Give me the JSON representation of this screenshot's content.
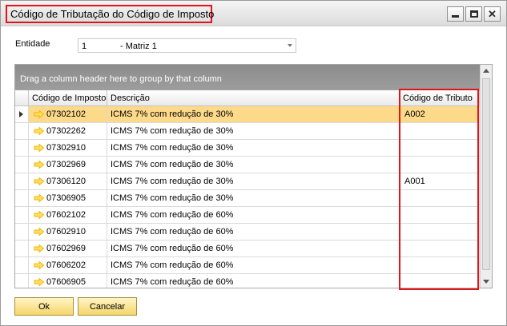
{
  "window": {
    "title": "Código de Tributação do Código de Imposto"
  },
  "entity": {
    "label": "Entidade",
    "code": "1",
    "name": "- Matriz 1"
  },
  "grid": {
    "group_panel_text": "Drag a column header here to group by that column",
    "columns": [
      "Código de Imposto",
      "Descrição",
      "Código de Tributo"
    ],
    "rows": [
      {
        "code": "07302102",
        "desc": "ICMS 7% com redução de 30%",
        "trib": "A002",
        "selected": true
      },
      {
        "code": "07302262",
        "desc": "ICMS 7% com redução de 30%",
        "trib": ""
      },
      {
        "code": "07302910",
        "desc": "ICMS 7% com redução de 30%",
        "trib": ""
      },
      {
        "code": "07302969",
        "desc": "ICMS 7% com redução de 30%",
        "trib": ""
      },
      {
        "code": "07306120",
        "desc": "ICMS 7% com redução de 30%",
        "trib": "A001"
      },
      {
        "code": "07306905",
        "desc": "ICMS 7% com redução de 30%",
        "trib": ""
      },
      {
        "code": "07602102",
        "desc": "ICMS 7% com redução de 60%",
        "trib": ""
      },
      {
        "code": "07602910",
        "desc": "ICMS 7% com redução de 60%",
        "trib": ""
      },
      {
        "code": "07602969",
        "desc": "ICMS 7% com redução de 60%",
        "trib": ""
      },
      {
        "code": "07606202",
        "desc": "ICMS 7% com redução de 60%",
        "trib": ""
      },
      {
        "code": "07606905",
        "desc": "ICMS 7% com redução de 60%",
        "trib": ""
      }
    ]
  },
  "buttons": {
    "ok": "Ok",
    "cancel": "Cancelar"
  },
  "colors": {
    "selected_row": "#fdd98a",
    "highlight_border": "#e2141a",
    "link_arrow": "#f5b400"
  },
  "icons": {
    "row_link": "link-arrow-icon",
    "row_indicator": "row-indicator-icon"
  }
}
